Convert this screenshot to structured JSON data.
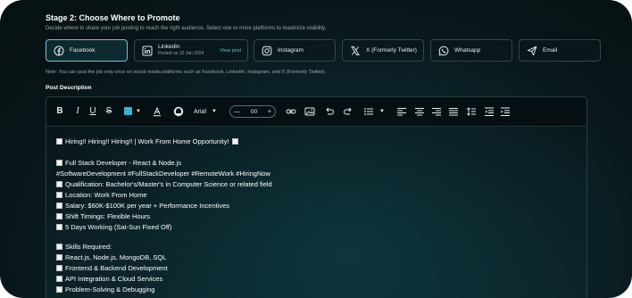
{
  "stage": {
    "title": "Stage 2: Choose Where to Promote",
    "description": "Decide where to share your job posting to reach the right audience. Select one or more platforms to maximize visibility."
  },
  "platforms": [
    {
      "label": "Facebook",
      "icon": "facebook-icon",
      "selected": true
    },
    {
      "label": "LinkedIn",
      "posted": "Posted on 10 Jan 2024",
      "action": "View post",
      "icon": "linkedin-icon",
      "selected": false
    },
    {
      "label": "Instagram",
      "icon": "instagram-icon",
      "selected": false
    },
    {
      "label": "X (Formerly Twitter)",
      "icon": "x-icon",
      "selected": false
    },
    {
      "label": "Whatsapp",
      "icon": "whatsapp-icon",
      "selected": false
    },
    {
      "label": "Email",
      "icon": "send-icon",
      "selected": false
    }
  ],
  "note": "Note: You can post the job only once on social media platforms such as Facebook, LinkedIn, Instagram, and X (Formerly Twitter).",
  "post_description_label": "Post Description",
  "toolbar": {
    "font": "Arial",
    "font_size": "00",
    "text_color": "#3bb3cf"
  },
  "content": {
    "lines": [
      {
        "text": "Hiring!! Hiring!! Hiring!! | Work From Home Opportunity!",
        "box": true,
        "end_box": true
      },
      {
        "text": "Full Stack Developer - React & Node.js",
        "box": true
      },
      {
        "text": "#SoftwareDevelopment #FullStackDeveloper #RemoteWork #HiringNow",
        "box": false
      },
      {
        "text": "Qualification: Bachelor's/Master's in Computer Science or related field",
        "box": true
      },
      {
        "text": "Location: Work From Home",
        "box": true
      },
      {
        "text": "Salary: $60K-$100K per year + Performance Incentives",
        "box": true
      },
      {
        "text": "Shift Timings: Flexible Hours",
        "box": true
      },
      {
        "text": "5 Days Working (Sat-Sun Fixed Off)",
        "box": true
      },
      {
        "text": "Skills Required:",
        "box": true
      },
      {
        "text": "React.js, Node.js, MongoDB, SQL",
        "box": true
      },
      {
        "text": "Frontend & Backend Development",
        "box": true
      },
      {
        "text": "API Integration & Cloud Services",
        "box": true
      },
      {
        "text": "Problem-Solving & Debugging",
        "box": true
      }
    ]
  },
  "colors": {
    "accent": "#6cc6d6",
    "link": "#5fb8c9",
    "background": "#0b2227"
  }
}
